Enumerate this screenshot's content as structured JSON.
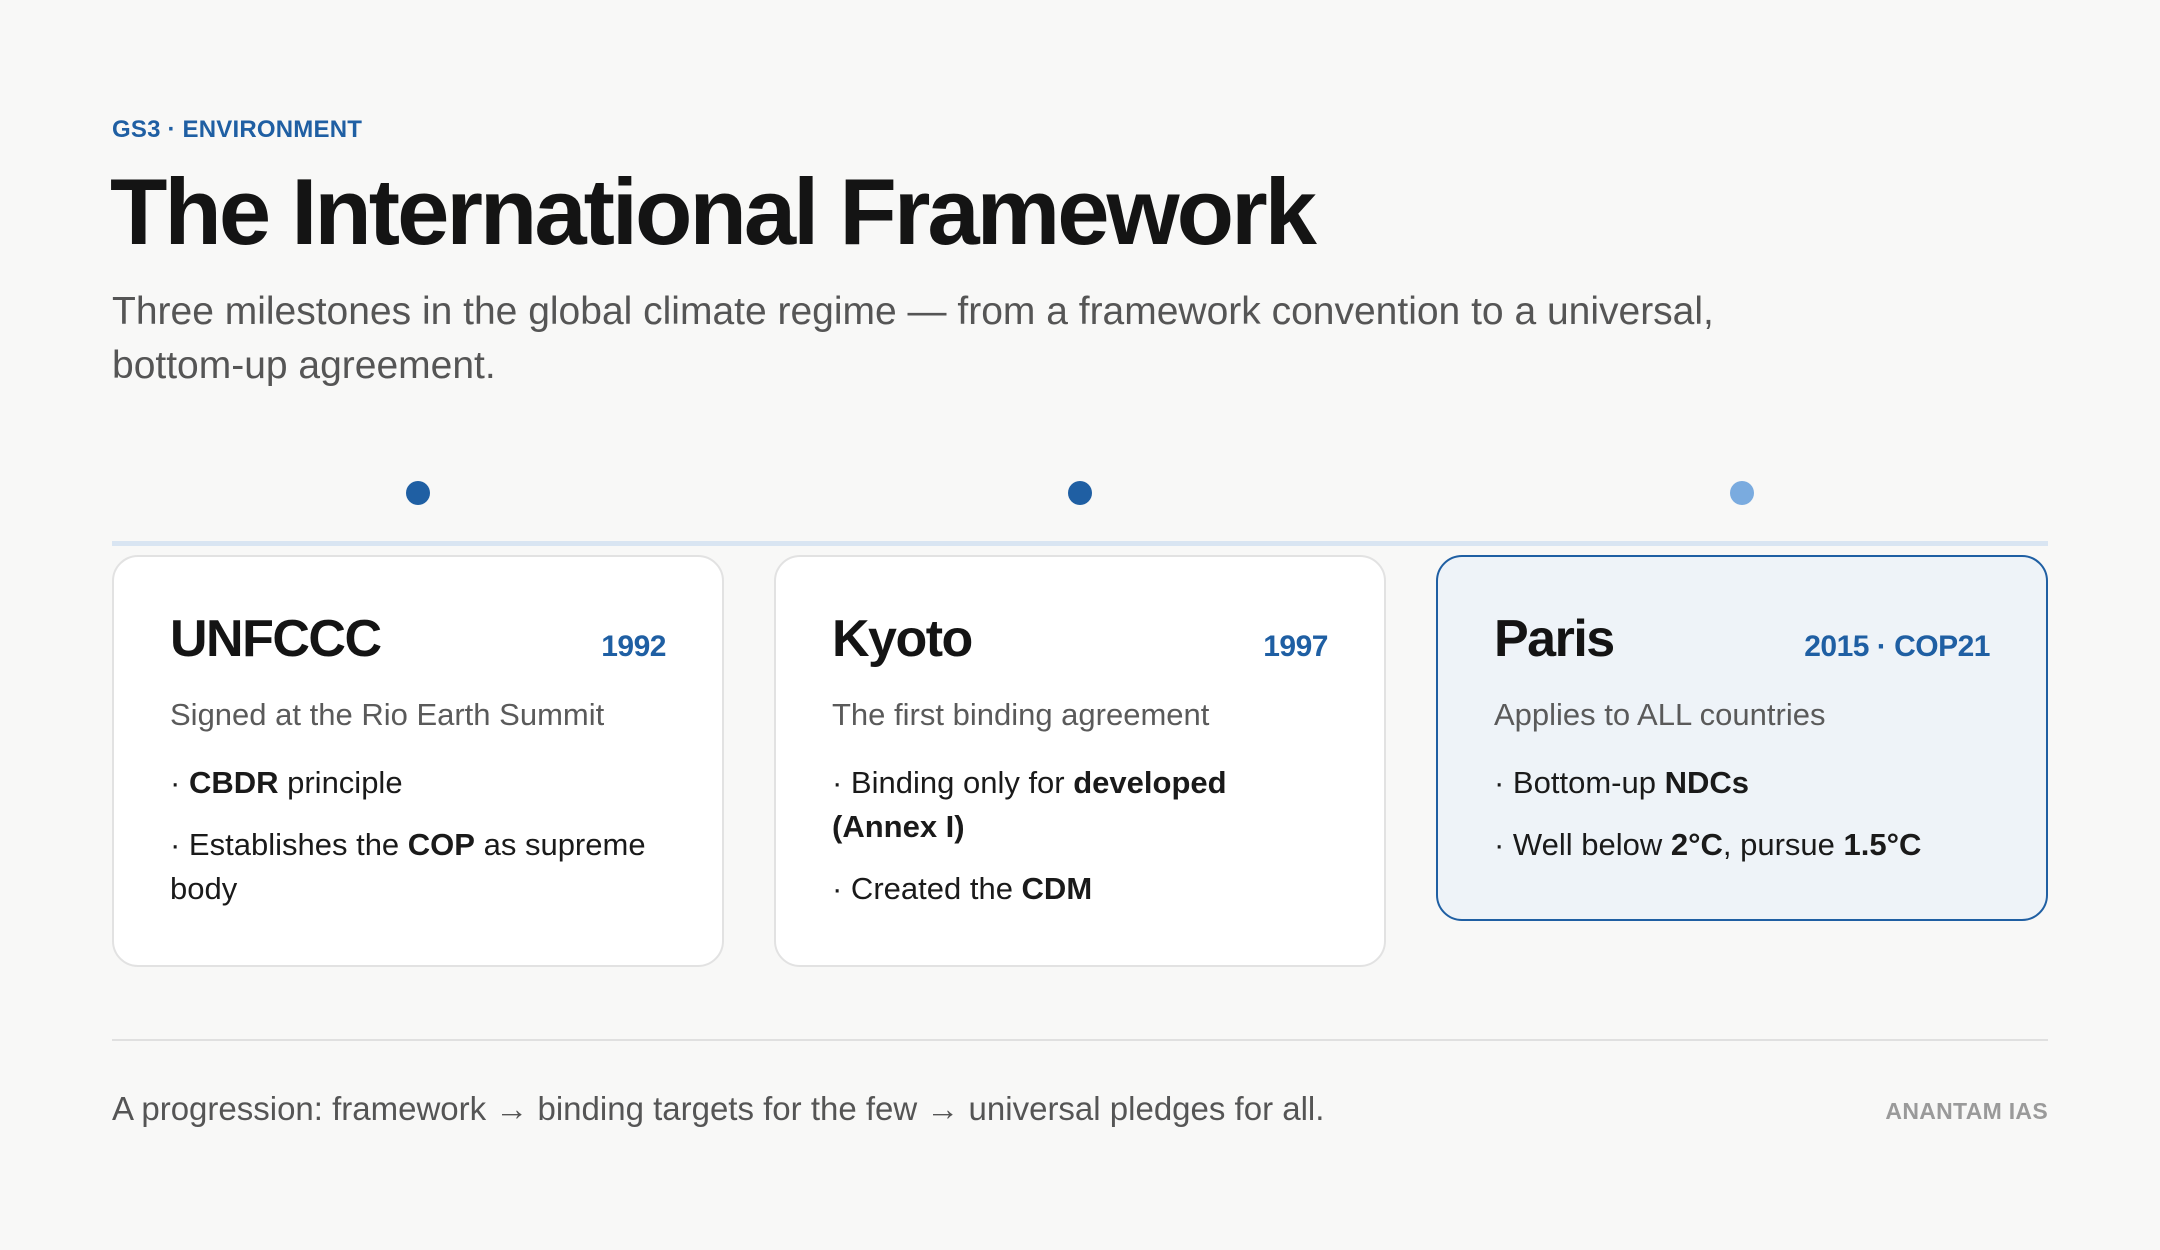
{
  "header": {
    "tag": "GS3 · ENVIRONMENT",
    "title": "The International Framework",
    "subtitle": "Three milestones in the global climate regime — from a framework convention to a universal, bottom-up agreement."
  },
  "colors": {
    "accent": "#1f5fa3",
    "accent_light": "#7aabdf",
    "timeline": "#d9e5f2",
    "highlight_bg": "#eef3f8"
  },
  "cards": [
    {
      "name": "UNFCCC",
      "year": "1992",
      "subtitle": "Signed at the Rio Earth Summit",
      "bullets": [
        {
          "pre": "· ",
          "bold": "CBDR",
          "post": " principle"
        },
        {
          "pre": "· Establishes the ",
          "bold": "COP",
          "post": " as supreme body"
        }
      ]
    },
    {
      "name": "Kyoto",
      "year": "1997",
      "subtitle": "The first binding agreement",
      "bullets": [
        {
          "pre": "· Binding only for ",
          "bold": "developed (Annex I)",
          "post": ""
        },
        {
          "pre": "· Created the ",
          "bold": "CDM",
          "post": ""
        }
      ]
    },
    {
      "name": "Paris",
      "year": "2015 · COP21",
      "subtitle": "Applies to ALL countries",
      "bullets": [
        {
          "pre": "· Bottom-up ",
          "bold": "NDCs",
          "post": ""
        },
        {
          "pre": "· Well below ",
          "bold": "2°C",
          "post": ", pursue ",
          "bold2": "1.5°C"
        }
      ]
    }
  ],
  "footer": {
    "text": "A progression: framework → binding targets for the few → universal pledges for all.",
    "brand": "ANANTAM IAS"
  }
}
